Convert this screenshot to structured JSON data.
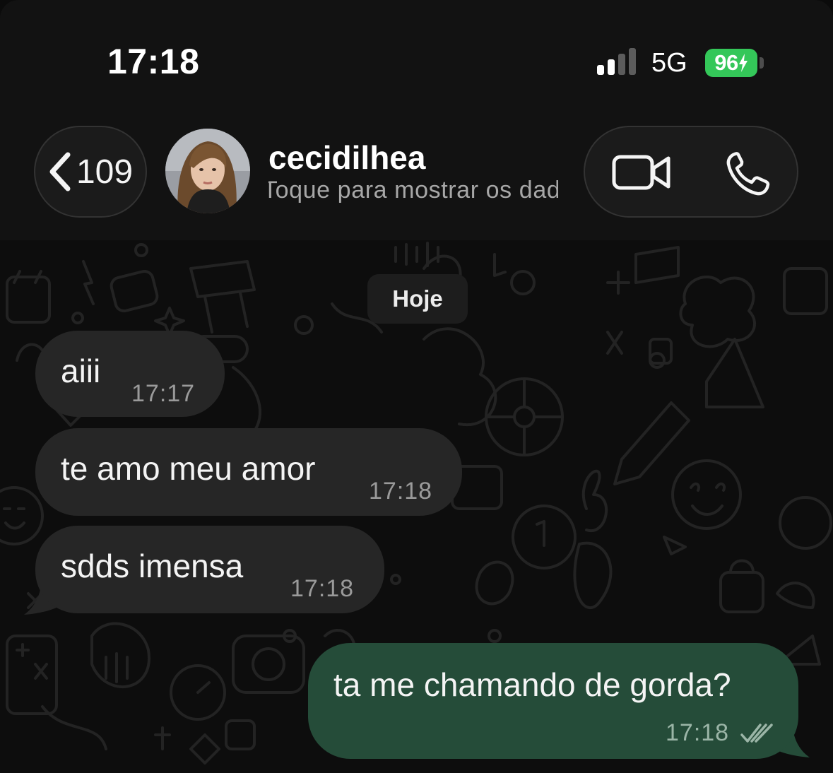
{
  "status_bar": {
    "time": "17:18",
    "network": "5G",
    "battery": "96"
  },
  "header": {
    "back_count": "109",
    "contact_name": "cecidilhea",
    "contact_subtitle": "Toque para mostrar os dados do contato"
  },
  "chat": {
    "date_label": "Hoje",
    "messages": [
      {
        "direction": "incoming",
        "text": "aiii",
        "time": "17:17"
      },
      {
        "direction": "incoming",
        "text": "te amo meu amor",
        "time": "17:18"
      },
      {
        "direction": "incoming",
        "text": "sdds imensa",
        "time": "17:18"
      },
      {
        "direction": "outgoing",
        "text": "ta me chamando de gorda?",
        "time": "17:18",
        "status": "read"
      }
    ]
  },
  "colors": {
    "incoming_bubble": "#262626",
    "outgoing_bubble": "#254c39",
    "battery": "#34c759",
    "header_bg": "#121212"
  },
  "icons": [
    "signal-bars-icon",
    "battery-charging-icon",
    "chevron-left-icon",
    "video-camera-icon",
    "phone-icon",
    "double-check-icon"
  ]
}
